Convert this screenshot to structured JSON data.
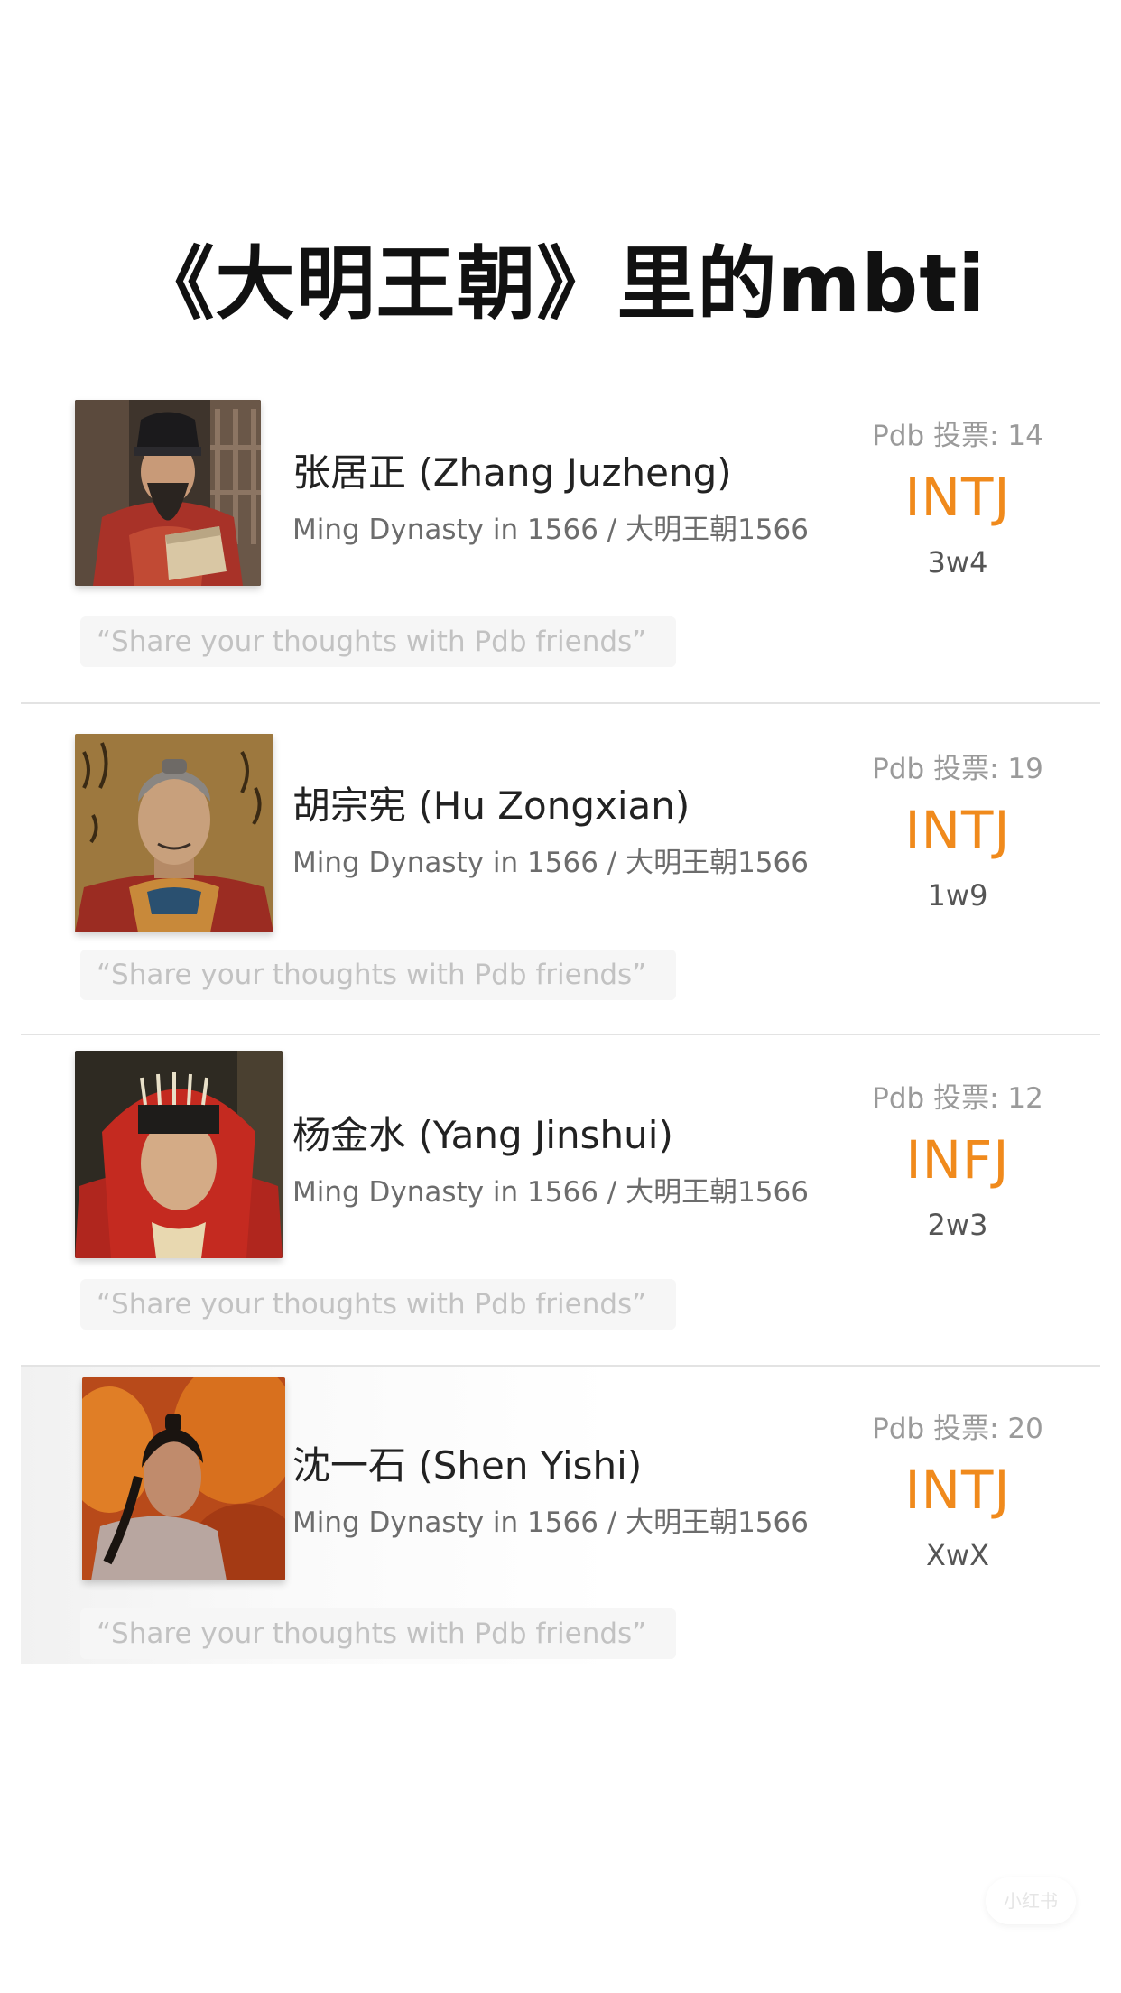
{
  "title": "《大明王朝》里的mbti",
  "characters": [
    {
      "name": "张居正 (Zhang Juzheng)",
      "subtitle": "Ming Dynasty in 1566 / 大明王朝1566",
      "votes": "Pdb 投票: 14",
      "mbti": "INTJ",
      "enneagram": "3w4",
      "comment_placeholder": "“Share your thoughts with Pdb friends”"
    },
    {
      "name": "胡宗宪 (Hu Zongxian)",
      "subtitle": "Ming Dynasty in 1566 / 大明王朝1566",
      "votes": "Pdb 投票: 19",
      "mbti": "INTJ",
      "enneagram": "1w9",
      "comment_placeholder": "“Share your thoughts with Pdb friends”"
    },
    {
      "name": "杨金水 (Yang Jinshui)",
      "subtitle": "Ming Dynasty in 1566 / 大明王朝1566",
      "votes": "Pdb 投票: 12",
      "mbti": "INFJ",
      "enneagram": "2w3",
      "comment_placeholder": "“Share your thoughts with Pdb friends”"
    },
    {
      "name": "沈一石 (Shen Yishi)",
      "subtitle": "Ming Dynasty in 1566 / 大明王朝1566",
      "votes": "Pdb 投票: 20",
      "mbti": "INTJ",
      "enneagram": "XwX",
      "comment_placeholder": "“Share your thoughts with Pdb friends”"
    }
  ],
  "watermark": "小红书",
  "colors": {
    "mbti_accent": "#f08a1c",
    "divider": "#e3e3e3",
    "comment_bg": "#f6f6f6"
  }
}
